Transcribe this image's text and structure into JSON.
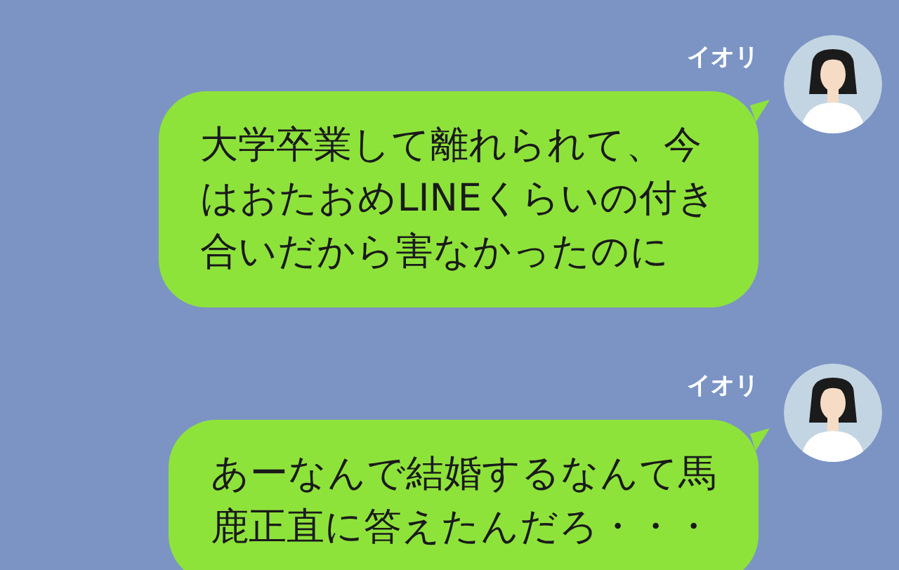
{
  "messages": [
    {
      "sender": "イオリ",
      "lines": [
        "大学卒業して離れられて、今",
        "はおたおめLINEくらいの付き",
        "合いだから害なかったのに"
      ]
    },
    {
      "sender": "イオリ",
      "lines": [
        "あーなんで結婚するなんて馬",
        "鹿正直に答えたんだろ・・・"
      ]
    }
  ]
}
